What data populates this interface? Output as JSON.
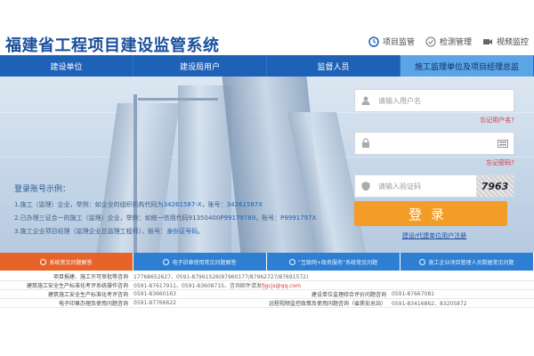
{
  "header": {
    "title": "福建省工程项目建设监管系统",
    "links": [
      {
        "label": "项目监管",
        "icon": "clock-icon"
      },
      {
        "label": "检测管理",
        "icon": "check-circle-icon"
      },
      {
        "label": "视频监控",
        "icon": "camera-icon"
      }
    ]
  },
  "nav": {
    "items": [
      "建设单位",
      "建设局用户",
      "监督人员",
      "施工监理单位及项目经理总监"
    ]
  },
  "tips": {
    "title": "登录账号示例：",
    "line1_prefix": "1.施工（监理）企业，举例：如企业的组织机构代码为",
    "line1_code": "34261587-X",
    "line1_mid": "，账号：",
    "line1_account": "34261587X",
    "line2_prefix": "2.已办理三证合一的施工（监理）企业，举例：如统一信用代码91350400",
    "line2_code": "P99179789",
    "line2_mid": "，账号：",
    "line2_account": "P9991797X",
    "line3_prefix": "3.施工企业项目经理（监理企业总监理工程师），账号：",
    "line3_account": "身份证号码。"
  },
  "login": {
    "username_placeholder": "请输入用户名",
    "forgot_username": "忘记用户名?",
    "password_placeholder": "",
    "forgot_password": "忘记密码?",
    "captcha_placeholder": "请输入验证码",
    "captcha_text": "7963",
    "login_label": "登录",
    "register_label": "建设/代建单位用户注册"
  },
  "tabs": [
    "系统常见问题解答",
    "电子印章使用常见问题解答",
    "“互联网+政务服务”系统常见问题",
    "施工企业项目管理人员数据常见问题"
  ],
  "table": {
    "rows": [
      {
        "k": "项目报建、施工许可审批等咨询",
        "v": "17768652627、0591-87961526(87960177/87962727/87691572)"
      },
      {
        "k": "建筑施工安全生产标准化考评系统操作咨询",
        "v": "0591-87617911、0591-83608715、咨询邮件请发",
        "red": "fjgcjs@qq.com"
      },
      {
        "k": "建筑施工安全生产标准化考评咨询",
        "v": "0591-83660163",
        "k2": "建设单位监理综合评价问题咨询",
        "v2": "0591-87667081"
      },
      {
        "k": "电子印章办理及使用问题咨询",
        "v": "0591-87766622",
        "k2": "远程视频监控政策及使用问题咨询（省质安总站）",
        "v2": "0591-83416862、83205872"
      }
    ]
  },
  "colors": {
    "nav": "#1e62b8",
    "nav_active": "#5ba4e6",
    "login_button": "#f39c27",
    "tab": "#2d7fd3",
    "tab_active": "#e8632a"
  }
}
